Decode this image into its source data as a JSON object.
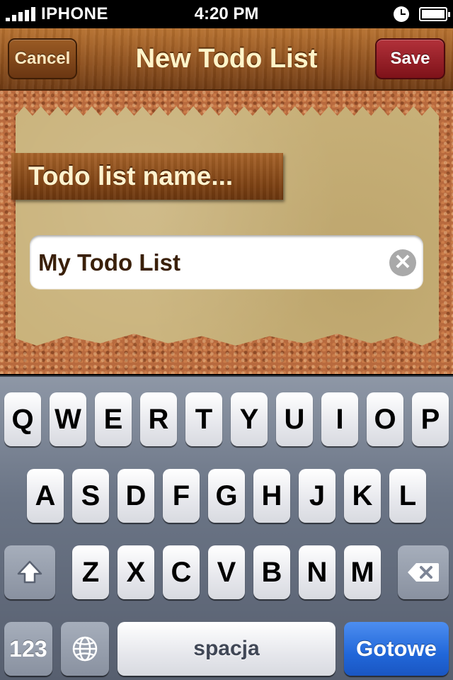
{
  "status_bar": {
    "carrier": "IPHONE",
    "time": "4:20 PM",
    "icons": [
      "signal-icon",
      "clock-icon",
      "battery-icon"
    ]
  },
  "nav": {
    "title": "New Todo List",
    "cancel_label": "Cancel",
    "save_label": "Save"
  },
  "form": {
    "label": "Todo list name...",
    "value": "My Todo List",
    "clear_glyph": "✕"
  },
  "keyboard": {
    "row1": [
      "Q",
      "W",
      "E",
      "R",
      "T",
      "Y",
      "U",
      "I",
      "O",
      "P"
    ],
    "row2": [
      "A",
      "S",
      "D",
      "F",
      "G",
      "H",
      "J",
      "K",
      "L"
    ],
    "row3": [
      "Z",
      "X",
      "C",
      "V",
      "B",
      "N",
      "M"
    ],
    "numbers_label": "123",
    "space_label": "spacja",
    "done_label": "Gotowe",
    "icons": [
      "shift-icon",
      "backspace-icon",
      "globe-icon"
    ]
  },
  "colors": {
    "nav_wood": "#8c4f1d",
    "save_red": "#9a1f28",
    "cork": "#b86a3e",
    "paper": "#c9b27a",
    "done_blue": "#2167d9"
  }
}
